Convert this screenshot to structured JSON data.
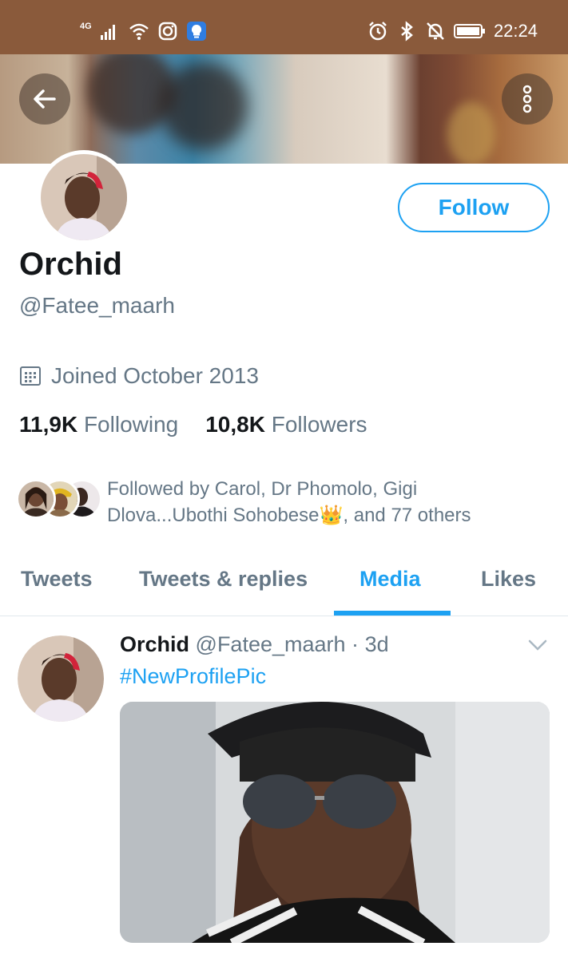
{
  "status_bar": {
    "network": "4G",
    "time": "22:24"
  },
  "profile": {
    "name": "Orchid",
    "handle": "@Fatee_maarh",
    "joined": "Joined October 2013",
    "following_count": "11,9K",
    "following_label": "Following",
    "followers_count": "10,8K",
    "followers_label": "Followers",
    "followed_by": "Followed by Carol, Dr Phomolo, Gigi Dlova...Ubothi Sohobese",
    "followed_by_emoji": "👑",
    "followed_by_suffix": ", and 77 others",
    "follow_button": "Follow"
  },
  "tabs": [
    {
      "label": "Tweets"
    },
    {
      "label": "Tweets & replies"
    },
    {
      "label": "Media",
      "active": true
    },
    {
      "label": "Likes"
    }
  ],
  "tweet": {
    "author_name": "Orchid",
    "author_handle": "@Fatee_maarh",
    "separator": "·",
    "time": "3d",
    "text": "#NewProfilePic"
  },
  "colors": {
    "accent": "#1da1f2",
    "status_bar": "#8a5a3b",
    "secondary_text": "#657786",
    "primary_text": "#14171a"
  },
  "icons": {
    "back": "arrow-left-icon",
    "more": "more-vertical-icon",
    "calendar": "calendar-icon",
    "caret": "chevron-down-icon"
  }
}
